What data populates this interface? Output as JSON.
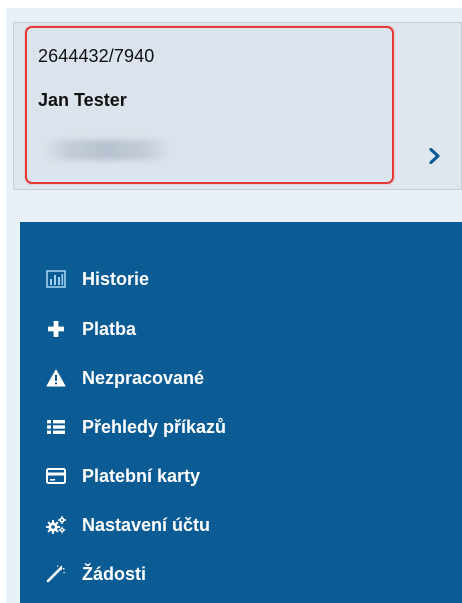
{
  "account": {
    "number": "2644432/7940",
    "name": "Jan Tester",
    "chevron_icon": "chevron-right-icon"
  },
  "nav": {
    "items": [
      {
        "label": "Historie",
        "icon": "bar-chart-icon"
      },
      {
        "label": "Platba",
        "icon": "plus-icon"
      },
      {
        "label": "Nezpracované",
        "icon": "warning-icon"
      },
      {
        "label": "Přehledy příkazů",
        "icon": "list-icon"
      },
      {
        "label": "Platební karty",
        "icon": "credit-card-icon"
      },
      {
        "label": "Nastavení účtu",
        "icon": "gears-icon"
      },
      {
        "label": "Žádosti",
        "icon": "magic-wand-icon"
      }
    ]
  },
  "colors": {
    "nav_background": "#0b5c95",
    "panel_background": "#e8f0f8",
    "highlight_border": "#e53935",
    "chevron": "#0b5c95"
  }
}
